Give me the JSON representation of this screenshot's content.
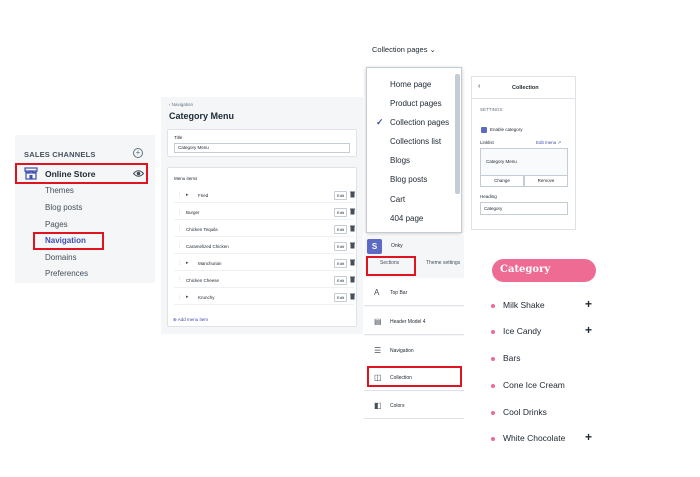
{
  "sales_channels": {
    "header": "SALES CHANNELS",
    "online_store": "Online Store",
    "items": [
      "Themes",
      "Blog posts",
      "Pages",
      "Navigation",
      "Domains",
      "Preferences"
    ]
  },
  "menu_editor": {
    "breadcrumb": "‹ Navigation",
    "title": "Category Menu",
    "title_label": "Title",
    "title_value": "Category Menu",
    "menu_items_label": "Menu items",
    "items": [
      "Fried",
      "Burger",
      "Chicken Tequila",
      "Caramelized Chicken",
      "Manchurian",
      "Chicken Cheese",
      "Krunchy"
    ],
    "edit_label": "Edit",
    "add_label": "Add menu item"
  },
  "theme_editor": {
    "dropdown_label": "Collection pages",
    "options": [
      "Home page",
      "Product pages",
      "Collection pages",
      "Collections list",
      "Blogs",
      "Blog posts",
      "Cart",
      "404 page"
    ],
    "store_name": "Onky",
    "tabs": [
      "Sections",
      "Theme settings"
    ],
    "sections": [
      "Top Bar",
      "Header Model 4",
      "Navigation",
      "Collection",
      "Colors"
    ]
  },
  "collection_settings": {
    "title": "Collection",
    "settings_label": "SETTINGS",
    "enable_label": "Enable category",
    "linklist_label": "Linklist",
    "edit_menu_label": "Edit menu",
    "linklist_value": "Category Menu",
    "change_label": "Change",
    "remove_label": "Remove",
    "heading_label": "Heading",
    "heading_value": "Category"
  },
  "category_widget": {
    "title": "Category",
    "items": [
      {
        "name": "Milk Shake",
        "plus": "+"
      },
      {
        "name": "Ice Candy",
        "plus": "+"
      },
      {
        "name": "Bars",
        "plus": ""
      },
      {
        "name": "Cone Ice Cream",
        "plus": ""
      },
      {
        "name": "Cool Drinks",
        "plus": ""
      },
      {
        "name": "White Chocolate",
        "plus": "+"
      }
    ],
    "accent": "#ee6b94"
  }
}
